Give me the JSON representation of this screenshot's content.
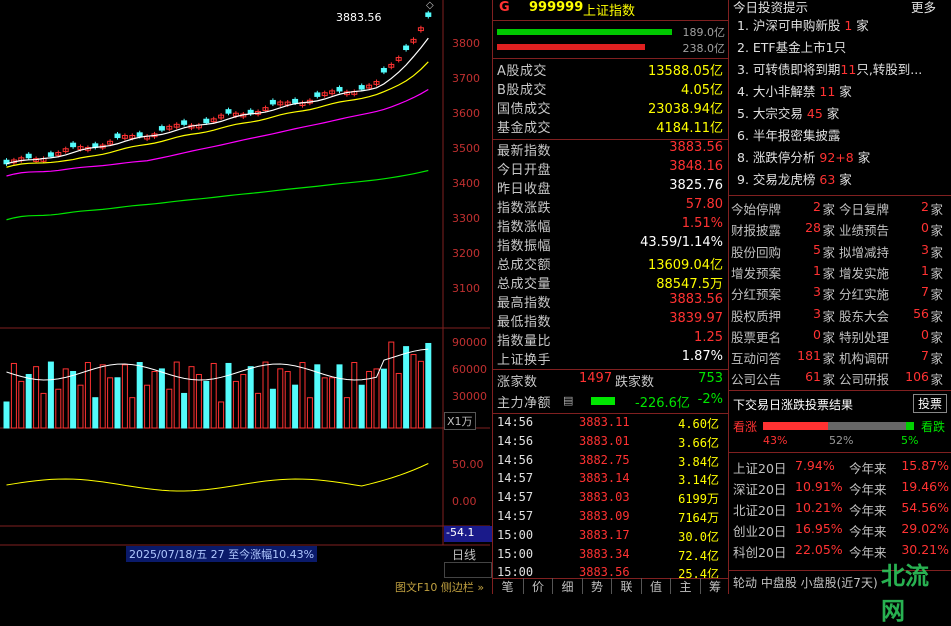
{
  "chart": {
    "price_top_label": "3883.56",
    "price_axis": [
      "3800",
      "3700",
      "3600",
      "3500",
      "3400",
      "3300",
      "3200",
      "3100"
    ],
    "vol_axis": [
      "90000",
      "60000",
      "30000"
    ],
    "vol_unit_button": "X1万",
    "ind_axis": [
      "50.00",
      "0.00"
    ],
    "ind_value": "-54.1",
    "status_bar": "2025/07/18/五 27 至今涨幅10.43%",
    "period_button": "日线",
    "bottom_links": "图文F10 侧边栏 »",
    "colors": {
      "up": "#ff3232",
      "down": "#54fcfc",
      "ma5": "#ffffff",
      "ma10": "#ffff00",
      "ma20": "#ff00ff",
      "ma60": "#00e600"
    }
  },
  "quote": {
    "code_prefix": "G",
    "code": "999999",
    "name": "上证指数",
    "bar1_value": "189.0亿",
    "bar2_value": "238.0亿",
    "turnover": [
      {
        "k": "A股成交",
        "v": "13588.05亿"
      },
      {
        "k": "B股成交",
        "v": "4.05亿"
      },
      {
        "k": "国债成交",
        "v": "23038.94亿"
      },
      {
        "k": "基金成交",
        "v": "4184.11亿"
      }
    ],
    "stats": [
      {
        "k": "最新指数",
        "v": "3883.56",
        "c": "red"
      },
      {
        "k": "今日开盘",
        "v": "3848.16",
        "c": "red"
      },
      {
        "k": "昨日收盘",
        "v": "3825.76",
        "c": "wht"
      },
      {
        "k": "指数涨跌",
        "v": "57.80",
        "c": "red"
      },
      {
        "k": "指数涨幅",
        "v": "1.51%",
        "c": "red"
      },
      {
        "k": "指数振幅",
        "v": "43.59/1.14%",
        "c": "wht"
      },
      {
        "k": "总成交额",
        "v": "13609.04亿",
        "c": "yel"
      },
      {
        "k": "总成交量",
        "v": "88547.5万",
        "c": "yel"
      },
      {
        "k": "最高指数",
        "v": "3883.56",
        "c": "red"
      },
      {
        "k": "最低指数",
        "v": "3839.97",
        "c": "red"
      },
      {
        "k": "指数量比",
        "v": "1.25",
        "c": "red"
      },
      {
        "k": "上证换手",
        "v": "1.87%",
        "c": "wht"
      }
    ],
    "up_label": "涨家数",
    "up_count": "1497",
    "down_label": "跌家数",
    "down_count": "753",
    "mainflow_label": "主力净额",
    "mainflow_value": "-226.6亿",
    "mainflow_pct": "-2%",
    "ticks": [
      {
        "t": "14:56",
        "p": "3883.11",
        "v": "4.60亿"
      },
      {
        "t": "14:56",
        "p": "3883.01",
        "v": "3.66亿"
      },
      {
        "t": "14:56",
        "p": "3882.75",
        "v": "3.84亿"
      },
      {
        "t": "14:57",
        "p": "3883.14",
        "v": "3.14亿"
      },
      {
        "t": "14:57",
        "p": "3883.03",
        "v": "6199万"
      },
      {
        "t": "14:57",
        "p": "3883.09",
        "v": "7164万"
      },
      {
        "t": "15:00",
        "p": "3883.17",
        "v": "30.0亿"
      },
      {
        "t": "15:00",
        "p": "3883.34",
        "v": "72.4亿"
      },
      {
        "t": "15:00",
        "p": "3883.56",
        "v": "25.4亿"
      }
    ],
    "bottom_tabs": [
      "笔",
      "价",
      "细",
      "势",
      "联",
      "值",
      "主",
      "筹"
    ]
  },
  "right": {
    "title": "今日投资提示",
    "more": "更多",
    "tips": [
      {
        "pre": "1. 沪深可申购新股 ",
        "num": "1",
        "post": " 家"
      },
      {
        "pre": "2. ETF基金上市1只",
        "num": "",
        "post": ""
      },
      {
        "pre": "3. 可转债即将到期",
        "num": "11",
        "post": "只,转股到..."
      },
      {
        "pre": "4. 大小非解禁 ",
        "num": "11",
        "post": " 家"
      },
      {
        "pre": "5. 大宗交易 ",
        "num": "45",
        "post": " 家"
      },
      {
        "pre": "6. 半年报密集披露",
        "num": "",
        "post": ""
      },
      {
        "pre": "8. 涨跌停分析 ",
        "num": "92+8",
        "post": " 家"
      },
      {
        "pre": "9. 交易龙虎榜 ",
        "num": "63",
        "post": " 家"
      }
    ],
    "grid": [
      [
        {
          "k": "今始停牌",
          "n": "2"
        },
        {
          "k": "今日复牌",
          "n": "2"
        }
      ],
      [
        {
          "k": "财报披露",
          "n": "28"
        },
        {
          "k": "业绩预告",
          "n": "0"
        }
      ],
      [
        {
          "k": "股份回购",
          "n": "5"
        },
        {
          "k": "拟增减持",
          "n": "3"
        }
      ],
      [
        {
          "k": "增发预案",
          "n": "1"
        },
        {
          "k": "增发实施",
          "n": "1"
        }
      ],
      [
        {
          "k": "分红预案",
          "n": "3"
        },
        {
          "k": "分红实施",
          "n": "7"
        }
      ],
      [
        {
          "k": "股权质押",
          "n": "3"
        },
        {
          "k": "股东大会",
          "n": "56"
        }
      ],
      [
        {
          "k": "股票更名",
          "n": "0"
        },
        {
          "k": "特别处理",
          "n": "0"
        }
      ],
      [
        {
          "k": "互动问答",
          "n": "181"
        },
        {
          "k": "机构调研",
          "n": "7"
        }
      ],
      [
        {
          "k": "公司公告",
          "n": "61"
        },
        {
          "k": "公司研报",
          "n": "106"
        }
      ]
    ],
    "unit": "家",
    "vote_title": "下交易日涨跌投票结果",
    "vote_button": "投票",
    "vote_up": "看涨",
    "vote_down": "看跌",
    "vote_up_pct": "43%",
    "vote_mid_pct": "52%",
    "vote_down_pct": "5%",
    "perf": [
      {
        "a": "上证20日",
        "av": "7.94%",
        "b": "今年来",
        "bv": "15.87%"
      },
      {
        "a": "深证20日",
        "av": "10.91%",
        "b": "今年来",
        "bv": "19.46%"
      },
      {
        "a": "北证20日",
        "av": "10.21%",
        "b": "今年来",
        "bv": "54.56%"
      },
      {
        "a": "创业20日",
        "av": "16.95%",
        "b": "今年来",
        "bv": "29.02%"
      },
      {
        "a": "科创20日",
        "av": "22.05%",
        "b": "今年来",
        "bv": "30.21%"
      }
    ],
    "bottom_bar": "轮动 中盘股 小盘股(近7天)",
    "watermark": "北流网"
  }
}
